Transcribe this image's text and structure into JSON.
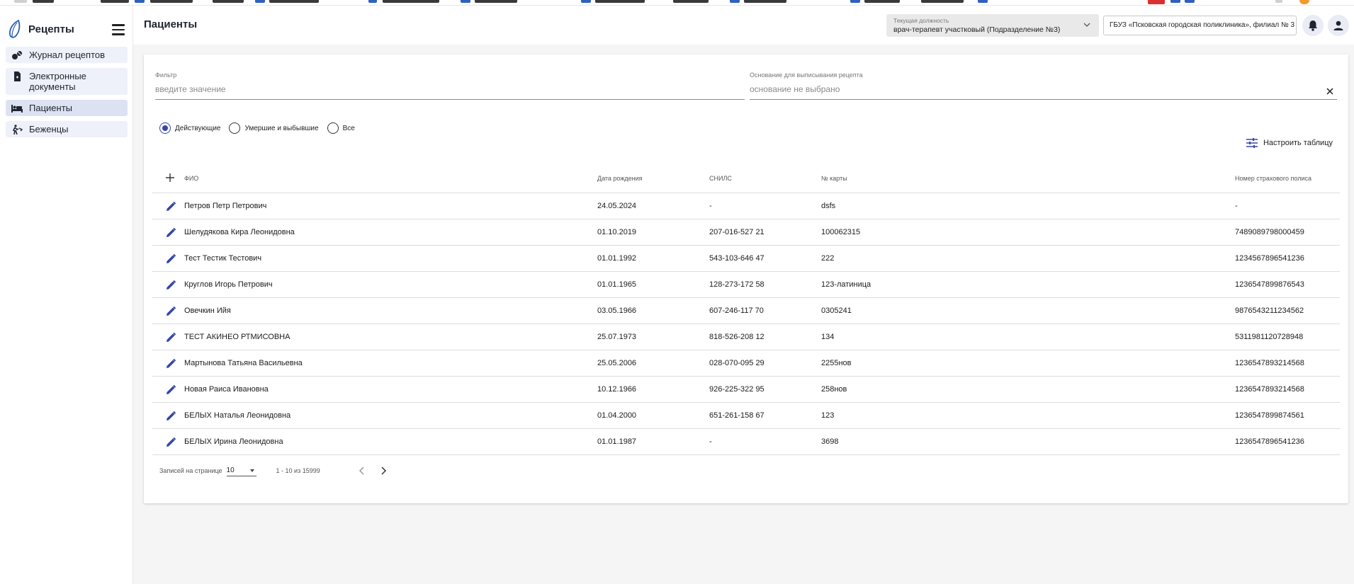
{
  "app": {
    "title": "Рецепты",
    "page_title": "Пациенты"
  },
  "sidebar": {
    "items": [
      {
        "label": "Журнал рецептов",
        "icon": "pills-icon"
      },
      {
        "label": "Электронные документы",
        "icon": "document-icon"
      },
      {
        "label": "Пациенты",
        "icon": "bed-icon",
        "active": true
      },
      {
        "label": "Беженцы",
        "icon": "refugee-icon"
      }
    ]
  },
  "header": {
    "position_caption": "Текущая должность",
    "position_value": "врач-терапевт участковый (Подразделение №3)",
    "organization": "ГБУЗ «Псковская городская поликлиника», филиал № 3"
  },
  "filters": {
    "filter_caption": "Фильтр",
    "filter_placeholder": "введите значение",
    "basis_caption": "Основание для выписывания рецепта",
    "basis_value": "основание не выбрано"
  },
  "status_radios": [
    {
      "label": "Действующие",
      "checked": true
    },
    {
      "label": "Умершие и выбывшие",
      "checked": false
    },
    {
      "label": "Все",
      "checked": false
    }
  ],
  "configure_table_label": "Настроить таблицу",
  "table": {
    "headers": {
      "name": "ФИО",
      "birth": "Дата рождения",
      "snils": "СНИЛС",
      "card": "№ карты",
      "policy": "Номер страхового полиса"
    },
    "rows": [
      {
        "name": "Петров Петр Петрович",
        "birth": "24.05.2024",
        "snils": "-",
        "card": "dsfs",
        "policy": "-"
      },
      {
        "name": "Шелудякова Кира Леонидовна",
        "birth": "01.10.2019",
        "snils": "207-016-527 21",
        "card": "100062315",
        "policy": "7489089798000459"
      },
      {
        "name": "Тест Тестик Тестович",
        "birth": "01.01.1992",
        "snils": "543-103-646 47",
        "card": "222",
        "policy": "1234567896541236"
      },
      {
        "name": "Круглов Игорь Петрович",
        "birth": "01.01.1965",
        "snils": "128-273-172 58",
        "card": "123-латиница",
        "policy": "1236547899876543"
      },
      {
        "name": "Овечкин Ийя",
        "birth": "03.05.1966",
        "snils": "607-246-117 70",
        "card": "0305241",
        "policy": "9876543211234562"
      },
      {
        "name": "ТЕСТ АКИНЕО РТМИСОВНА",
        "birth": "25.07.1973",
        "snils": "818-526-208 12",
        "card": "134",
        "policy": "5311981120728948"
      },
      {
        "name": "Мартынова Татьяна Васильевна",
        "birth": "25.05.2006",
        "snils": "028-070-095 29",
        "card": "2255нов",
        "policy": "1236547893214568"
      },
      {
        "name": "Новая Раиса Ивановна",
        "birth": "10.12.1966",
        "snils": "926-225-322 95",
        "card": "258нов",
        "policy": "1236547893214568"
      },
      {
        "name": "БЕЛЫХ Наталья Леонидовна",
        "birth": "01.04.2000",
        "snils": "651-261-158 67",
        "card": "123",
        "policy": "1236547899874561"
      },
      {
        "name": "БЕЛЫХ Ирина Леонидовна",
        "birth": "01.01.1987",
        "snils": "-",
        "card": "3698",
        "policy": "1236547896541236"
      }
    ]
  },
  "pagination": {
    "per_page_caption": "Записей на странице",
    "per_page_value": "10",
    "range": "1 - 10 из 15999"
  },
  "colors": {
    "accent": "#3347a8",
    "nav_bg": "#eef1f9",
    "nav_active_bg": "#dde2f2"
  }
}
